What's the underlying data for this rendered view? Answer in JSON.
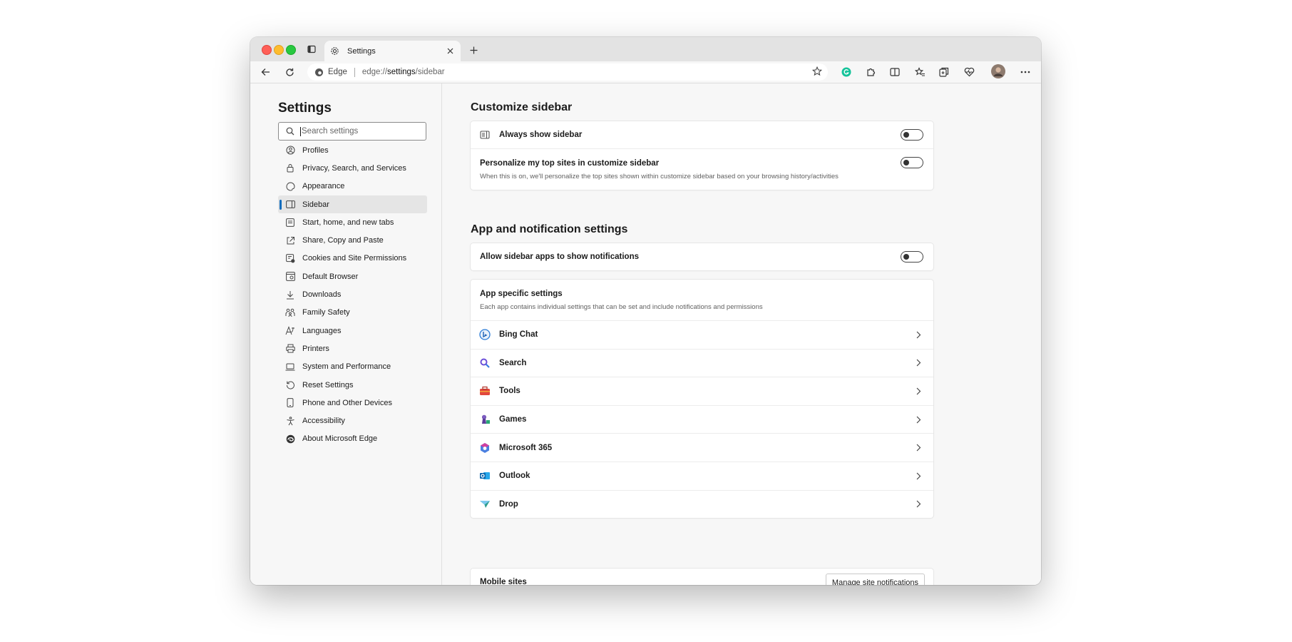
{
  "tab": {
    "title": "Settings"
  },
  "address": {
    "site_label": "Edge",
    "url_scheme": "edge://",
    "url_host": "settings",
    "url_path": "/sidebar"
  },
  "sidebar": {
    "title": "Settings",
    "search_placeholder": "Search settings",
    "items": [
      {
        "label": "Profiles",
        "icon": "profile-icon"
      },
      {
        "label": "Privacy, Search, and Services",
        "icon": "lock-icon"
      },
      {
        "label": "Appearance",
        "icon": "appearance-icon"
      },
      {
        "label": "Sidebar",
        "icon": "sidebar-icon",
        "active": true
      },
      {
        "label": "Start, home, and new tabs",
        "icon": "start-icon"
      },
      {
        "label": "Share, Copy and Paste",
        "icon": "share-icon"
      },
      {
        "label": "Cookies and Site Permissions",
        "icon": "cookies-icon"
      },
      {
        "label": "Default Browser",
        "icon": "browser-icon"
      },
      {
        "label": "Downloads",
        "icon": "download-icon"
      },
      {
        "label": "Family Safety",
        "icon": "family-icon"
      },
      {
        "label": "Languages",
        "icon": "languages-icon"
      },
      {
        "label": "Printers",
        "icon": "printer-icon"
      },
      {
        "label": "System and Performance",
        "icon": "laptop-icon"
      },
      {
        "label": "Reset Settings",
        "icon": "reset-icon"
      },
      {
        "label": "Phone and Other Devices",
        "icon": "phone-icon"
      },
      {
        "label": "Accessibility",
        "icon": "accessibility-icon"
      },
      {
        "label": "About Microsoft Edge",
        "icon": "edge-icon"
      }
    ]
  },
  "customize": {
    "heading": "Customize sidebar",
    "always_show": {
      "label": "Always show sidebar",
      "on": false
    },
    "personalize": {
      "label": "Personalize my top sites in customize sidebar",
      "desc": "When this is on, we'll personalize the top sites shown within customize sidebar based on your browsing history/activities",
      "on": false
    }
  },
  "app_notifications": {
    "heading": "App and notification settings",
    "allow": {
      "label": "Allow sidebar apps to show notifications",
      "on": false
    },
    "specific": {
      "title": "App specific settings",
      "desc": "Each app contains individual settings that can be set and include notifications and permissions"
    },
    "apps": [
      {
        "label": "Bing Chat",
        "icon": "bing-chat-icon"
      },
      {
        "label": "Search",
        "icon": "search-icon"
      },
      {
        "label": "Tools",
        "icon": "toolbox-icon"
      },
      {
        "label": "Games",
        "icon": "games-icon"
      },
      {
        "label": "Microsoft 365",
        "icon": "microsoft-365-icon"
      },
      {
        "label": "Outlook",
        "icon": "outlook-icon"
      },
      {
        "label": "Drop",
        "icon": "drop-icon"
      }
    ],
    "mobile": {
      "label": "Mobile sites",
      "button": "Manage site notifications"
    }
  }
}
